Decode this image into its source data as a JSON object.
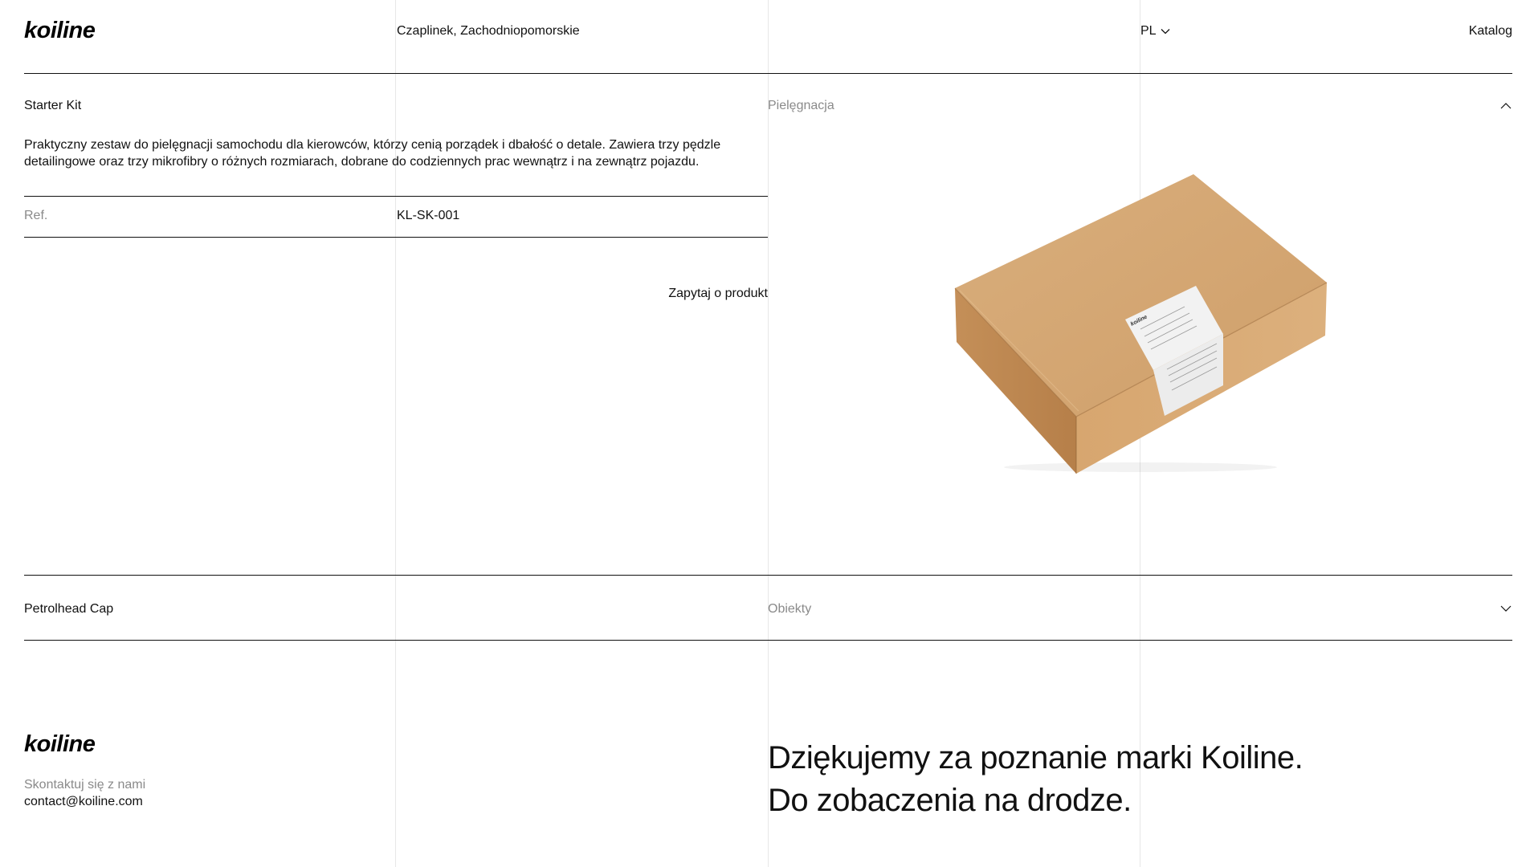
{
  "header": {
    "logo": "koiline",
    "location": "Czaplinek, Zachodniopomorskie",
    "language": "PL",
    "catalog_link": "Katalog"
  },
  "products": [
    {
      "name": "Starter Kit",
      "category": "Pielęgnacja",
      "expanded": true,
      "description": "Praktyczny zestaw do pielęgnacji samochodu dla kierowców, którzy cenią porządek i dbałość o detale. Zawiera trzy pędzle detailingowe oraz trzy mikrofibry o różnych rozmiarach, dobrane do codziennych prac wewnątrz i na zewnątrz pojazdu.",
      "ref_label": "Ref.",
      "ref_value": "KL-SK-001",
      "inquiry_button": "Zapytaj o produkt",
      "image_label": "koiline"
    },
    {
      "name": "Petrolhead Cap",
      "category": "Obiekty",
      "expanded": false
    }
  ],
  "footer": {
    "logo": "koiline",
    "contact_label": "Skontaktuj się z nami",
    "email": "contact@koiline.com",
    "thanks_line1": "Dziękujemy za poznanie marki Koiline.",
    "thanks_line2": "Do zobaczenia na drodze."
  },
  "colors": {
    "text": "#111111",
    "muted": "#8a8a8a",
    "grid": "#e7e7e7",
    "cardboard": "#d4a673"
  },
  "icons": {
    "language_toggle": "chevron-down-icon",
    "collapse_toggle": "chevron-up-icon",
    "expand_toggle": "chevron-down-icon"
  }
}
